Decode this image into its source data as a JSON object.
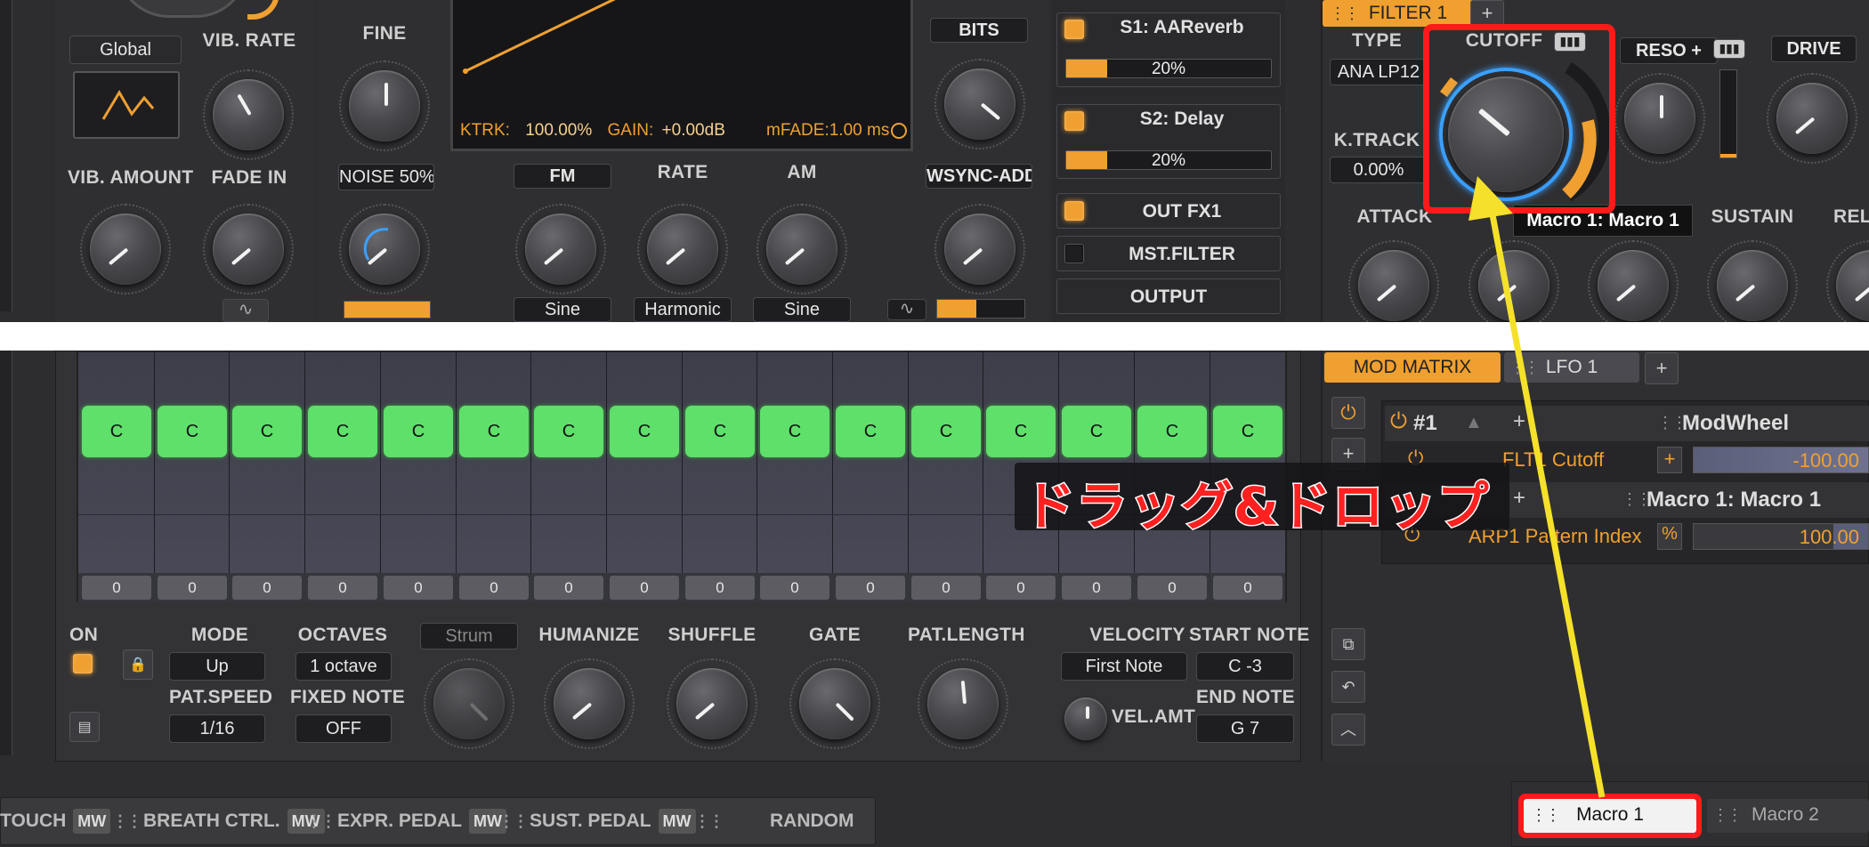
{
  "lfo": {
    "global": "Global",
    "vib_rate": "VIB. RATE",
    "vib_amount": "VIB. AMOUNT",
    "fade_in": "FADE IN"
  },
  "osc": {
    "fine": "FINE",
    "noise": "NOISE 50%",
    "fm": "FM",
    "rate": "RATE",
    "am": "AM",
    "fm_mode": "Sine",
    "rate_mode": "Harmonic",
    "am_mode": "Sine",
    "bits": "BITS",
    "wsync": "WSYNC-ADD",
    "ktrk_label": "KTRK:",
    "ktrk_value": "100.00%",
    "gain_label": "GAIN:",
    "gain_value": "+0.00dB",
    "mfade": "mFADE:1.00 ms"
  },
  "fx": {
    "s1": "S1: AAReverb",
    "s1_amount": "20%",
    "s1_fill": 0.2,
    "s2": "S2: Delay",
    "s2_amount": "20%",
    "s2_fill": 0.2,
    "out_fx1": "OUT FX1",
    "mst_filter": "MST.FILTER",
    "output": "OUTPUT"
  },
  "filter": {
    "tab": "FILTER 1",
    "add": "+",
    "type_label": "TYPE",
    "type_value": "ANA LP12",
    "cutoff": "CUTOFF",
    "reso": "RESO +",
    "drive": "DRIVE",
    "ktrack_label": "K.TRACK",
    "ktrack_value": "0.00%",
    "attack": "ATTACK",
    "sustain": "SUSTAIN",
    "release": "RELE",
    "tooltip": "Macro 1: Macro 1"
  },
  "mod": {
    "tab_matrix": "MOD MATRIX",
    "tab_lfo": "LFO 1",
    "add": "+",
    "slot1_num": "#1",
    "slot1_source": "ModWheel",
    "slot1_target": "FLT1 Cutoff",
    "slot1_value": "-100.00",
    "slot1_sign": "+",
    "slot2_source": "Macro 1: Macro 1",
    "slot2_target": "ARP1 Pattern Index",
    "slot2_value": "100.00",
    "slot2_sign": "%"
  },
  "overlay": {
    "drag_drop": "ドラッグ&ドロップ"
  },
  "arp": {
    "notes": [
      "C",
      "C",
      "C",
      "C",
      "C",
      "C",
      "C",
      "C",
      "C",
      "C",
      "C",
      "C",
      "C",
      "C",
      "C",
      "C"
    ],
    "velocities": [
      "0",
      "0",
      "0",
      "0",
      "0",
      "0",
      "0",
      "0",
      "0",
      "0",
      "0",
      "0",
      "0",
      "0",
      "0",
      "0"
    ],
    "on": "ON",
    "mode": "MODE",
    "mode_value": "Up",
    "octaves": "OCTAVES",
    "octaves_value": "1 octave",
    "pat_speed": "PAT.SPEED",
    "pat_speed_value": "1/16",
    "fixed_note": "FIXED NOTE",
    "fixed_note_value": "OFF",
    "strum": "Strum",
    "humanize": "HUMANIZE",
    "shuffle": "SHUFFLE",
    "gate": "GATE",
    "pat_length": "PAT.LENGTH",
    "velocity": "VELOCITY",
    "velocity_value": "First Note",
    "vel_amt": "VEL.AMT",
    "start_note": "START NOTE",
    "start_note_value": "C -3",
    "end_note": "END NOTE",
    "end_note_value": "G 7"
  },
  "sources": {
    "touch": "TOUCH",
    "breath": "BREATH CTRL.",
    "expr": "EXPR. PEDAL",
    "sust": "SUST. PEDAL",
    "random": "RANDOM",
    "mw": "MW"
  },
  "macros": {
    "macro1": "Macro 1",
    "macro2": "Macro 2"
  },
  "colors": {
    "accent": "#f0a030",
    "highlight": "#ff1a1a",
    "arrow": "#f5e12a",
    "step": "#5ee06a",
    "blue": "#3aa0ff"
  }
}
